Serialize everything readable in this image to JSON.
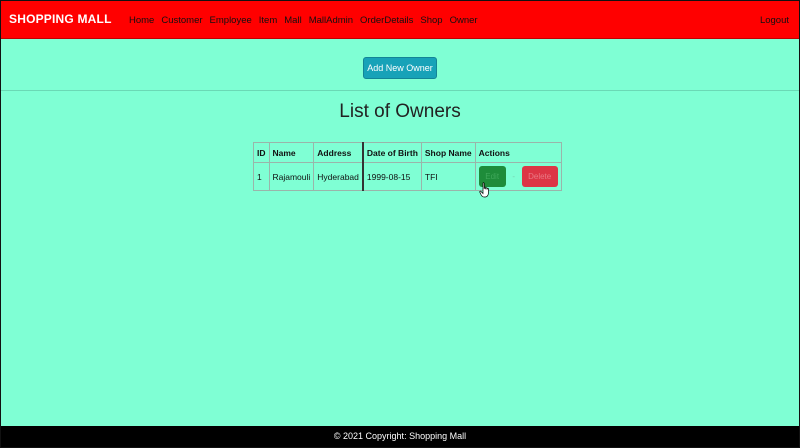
{
  "navbar": {
    "brand": "SHOPPING MALL",
    "links": [
      "Home",
      "Customer",
      "Employee",
      "Item",
      "Mall",
      "MallAdmin",
      "OrderDetails",
      "Shop",
      "Owner"
    ],
    "logout": "Logout",
    "bg_color": "#ff0000"
  },
  "toolbar": {
    "add_label": "Add New Owner"
  },
  "page": {
    "title": "List of Owners",
    "bg_color": "#7fffd4"
  },
  "table": {
    "headers": [
      "ID",
      "Name",
      "Address",
      "Date of Birth",
      "Shop Name",
      "Actions"
    ],
    "rows": [
      {
        "id": "1",
        "name": "Rajamouli",
        "address": "Hyderabad",
        "dob": "1999-08-15",
        "shop_name": "TFI",
        "edit_label": "Edit",
        "delete_label": "Delete"
      }
    ]
  },
  "footer": {
    "text": "© 2021 Copyright: Shopping Mall"
  },
  "icons": {
    "cursor": "hand-pointer-icon"
  }
}
